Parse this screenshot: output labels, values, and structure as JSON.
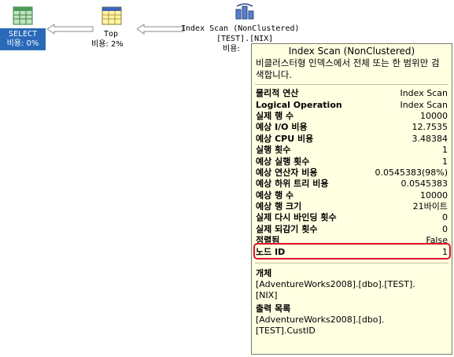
{
  "plan": {
    "select_node": {
      "name": "SELECT",
      "cost": "비용: 0%"
    },
    "top_node": {
      "name": "Top",
      "cost": "비용: 2%"
    },
    "scan_node": {
      "name": "Index Scan (NonClustered)",
      "object": "[TEST].[NIX]",
      "cost": "비용:"
    }
  },
  "tooltip": {
    "title": "Index Scan (NonClustered)",
    "description": "비클러스터형 인덱스에서 전체 또는 한 범위만 검색합니다.",
    "properties": [
      {
        "label": "물리적 연산",
        "value": "Index Scan"
      },
      {
        "label": "Logical Operation",
        "value": "Index Scan"
      },
      {
        "label": "실제 행 수",
        "value": "10000"
      },
      {
        "label": "예상 I/O 비용",
        "value": "12.7535"
      },
      {
        "label": "예상 CPU 비용",
        "value": "3.48384"
      },
      {
        "label": "실행 횟수",
        "value": "1"
      },
      {
        "label": "예상 실행 횟수",
        "value": "1"
      },
      {
        "label": "예상 연산자 비용",
        "value": "0.0545383(98%)"
      },
      {
        "label": "예상 하위 트리 비용",
        "value": "0.0545383"
      },
      {
        "label": "예상 행 수",
        "value": "10000"
      },
      {
        "label": "예상 행 크기",
        "value": "21바이트"
      },
      {
        "label": "실제 다시 바인딩 횟수",
        "value": "0"
      },
      {
        "label": "실제 되감기 횟수",
        "value": "0"
      },
      {
        "label": "정렬됨",
        "value": "False"
      },
      {
        "label": "노드 ID",
        "value": "1"
      }
    ],
    "object_heading": "개체",
    "object_lines": [
      "[AdventureWorks2008].[dbo].[TEST].",
      "[NIX]"
    ],
    "output_heading": "출력 목록",
    "output_lines": [
      "[AdventureWorks2008].[dbo].",
      "[TEST].CustID"
    ]
  },
  "colors": {
    "highlight": "#e0102a",
    "tooltip_bg": "#ffffe1",
    "selected_bg": "#2a69b8"
  }
}
